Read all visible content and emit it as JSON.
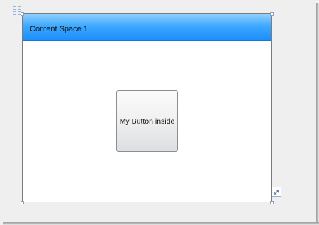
{
  "window": {
    "title": "Content Space 1"
  },
  "button": {
    "label": "My Button inside"
  },
  "icons": {
    "move": "move-icon",
    "resize": "resize-grip-icon"
  },
  "colors": {
    "header_top": "#8fd0ff",
    "header_bottom": "#1a8eff",
    "frame_border": "#7b7b7b",
    "surface": "#efefef"
  }
}
